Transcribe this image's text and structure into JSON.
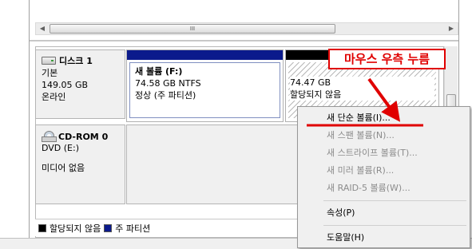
{
  "disks": {
    "disk1": {
      "name": "디스크 1",
      "type": "기본",
      "size": "149.05 GB",
      "status": "온라인",
      "icon": "hard-disk-icon"
    },
    "cdrom0": {
      "name": "CD-ROM 0",
      "type": "DVD (E:)",
      "media": "미디어 없음",
      "icon": "cd-drive-icon"
    }
  },
  "partitions": {
    "f": {
      "title": "새 볼륨  (F:)",
      "size": "74.58 GB NTFS",
      "status": "정상 (주 파티션)",
      "color": "#0b1a8c"
    },
    "unallocated": {
      "size": "74.47 GB",
      "status": "할당되지 않음",
      "color": "#000000"
    }
  },
  "scrollbar": {
    "thumb_grip": "III"
  },
  "legend": {
    "unallocated": "할당되지 않음",
    "primary": "주 파티션"
  },
  "context_menu": {
    "items": [
      {
        "label": "새 단순 볼륨(I)...",
        "enabled": true
      },
      {
        "label": "새 스팬 볼륨(N)...",
        "enabled": false
      },
      {
        "label": "새 스트라이프 볼륨(T)...",
        "enabled": false
      },
      {
        "label": "새 미러 볼륨(R)...",
        "enabled": false
      },
      {
        "label": "새 RAID-5 볼륨(W)...",
        "enabled": false
      }
    ],
    "properties": "속성(P)",
    "help": "도움말(H)"
  },
  "annotation": {
    "callout_text": "마우스 우측 누름",
    "color": "#e00000"
  }
}
